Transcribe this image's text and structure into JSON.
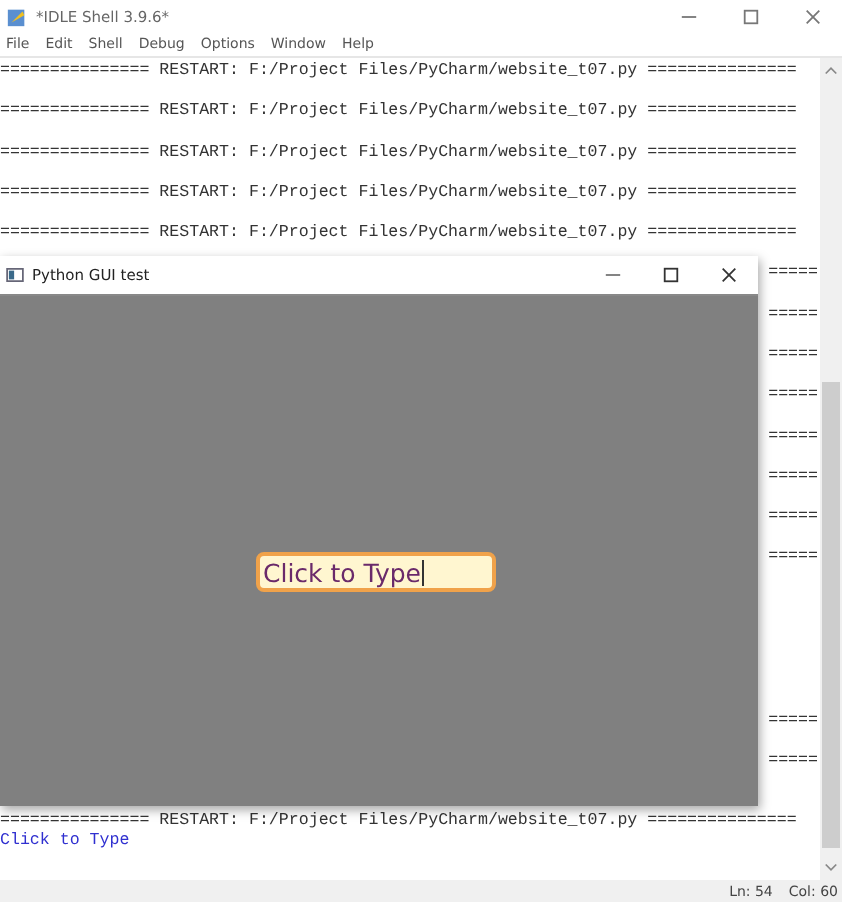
{
  "window": {
    "title": "*IDLE Shell 3.9.6*"
  },
  "menu": [
    "File",
    "Edit",
    "Shell",
    "Debug",
    "Options",
    "Window",
    "Help"
  ],
  "shell_rows": [
    {
      "kind": "restart",
      "text": "=============== RESTART: F:/Project Files/PyCharm/website_t07.py ==============="
    },
    {
      "kind": "blank"
    },
    {
      "kind": "restart",
      "text": "=============== RESTART: F:/Project Files/PyCharm/website_t07.py ==============="
    },
    {
      "kind": "blank"
    },
    {
      "kind": "restart",
      "text": "=============== RESTART: F:/Project Files/PyCharm/website_t07.py ==============="
    },
    {
      "kind": "blank"
    },
    {
      "kind": "restart",
      "text": "=============== RESTART: F:/Project Files/PyCharm/website_t07.py ==============="
    },
    {
      "kind": "blank"
    },
    {
      "kind": "restart",
      "text": "=============== RESTART: F:/Project Files/PyCharm/website_t07.py ==============="
    },
    {
      "kind": "blank"
    },
    {
      "kind": "fragment",
      "text": "====="
    },
    {
      "kind": "blank"
    },
    {
      "kind": "fragment",
      "text": "====="
    },
    {
      "kind": "blank"
    },
    {
      "kind": "fragment",
      "text": "====="
    },
    {
      "kind": "blank"
    },
    {
      "kind": "fragment",
      "text": "====="
    },
    {
      "kind": "blank"
    },
    {
      "kind": "fragment",
      "text": "====="
    },
    {
      "kind": "blank"
    },
    {
      "kind": "fragment",
      "text": "====="
    },
    {
      "kind": "blank"
    },
    {
      "kind": "fragment",
      "text": "====="
    },
    {
      "kind": "blank"
    },
    {
      "kind": "fragment",
      "text": "====="
    },
    {
      "kind": "blank"
    },
    {
      "kind": "blank"
    },
    {
      "kind": "blank"
    },
    {
      "kind": "blank"
    },
    {
      "kind": "blank"
    },
    {
      "kind": "blank"
    },
    {
      "kind": "blank"
    },
    {
      "kind": "fragment",
      "text": "====="
    },
    {
      "kind": "blank"
    },
    {
      "kind": "fragment",
      "text": "====="
    },
    {
      "kind": "blank"
    },
    {
      "kind": "blank"
    },
    {
      "kind": "restart",
      "text": "=============== RESTART: F:/Project Files/PyCharm/website_t07.py ==============="
    },
    {
      "kind": "output",
      "text": "Click to Type"
    }
  ],
  "status_bar": {
    "line": "Ln: 54",
    "column": "Col: 60"
  },
  "popup": {
    "title": "Python GUI test",
    "entry": {
      "value": "Click to Type",
      "focused": true
    }
  }
}
